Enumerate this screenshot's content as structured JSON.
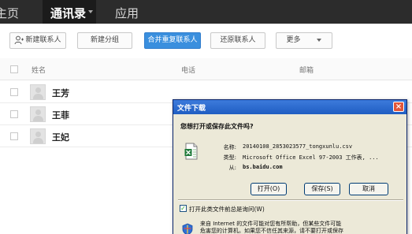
{
  "nav": {
    "home": "主页",
    "contacts": "通讯录",
    "apps": "应用"
  },
  "toolbar": {
    "new_contact": "新建联系人",
    "new_group": "新建分组",
    "merge": "合并重复联系人",
    "restore": "还原联系人",
    "more": "更多",
    "primary_color": "#3a8fde"
  },
  "table": {
    "columns": {
      "name": "姓名",
      "phone": "电话",
      "email": "邮箱"
    },
    "rows": [
      {
        "name": "王芳"
      },
      {
        "name": "王菲"
      },
      {
        "name": "王妃"
      }
    ]
  },
  "dialog": {
    "title": "文件下载",
    "question": "您想打开或保存此文件吗?",
    "fields": {
      "name_label": "名称:",
      "name_value": "20140108_2853023577_tongxunlu.csv",
      "type_label": "类型:",
      "type_value": "Microsoft Office Excel 97-2003 工作表, ...",
      "from_label": "从:",
      "from_value": "bs.baidu.com"
    },
    "buttons": {
      "open": "打开(O)",
      "save": "保存(S)",
      "cancel": "取消"
    },
    "always_ask_label": "打开此类文件前总是询问(W)",
    "always_ask_checked": true,
    "warning_line1": "来自 Internet 的文件可能对您有所帮助，但某些文件可能",
    "warning_line2": "危害您的计算机。如果您不信任其来源，请不要打开或保存"
  }
}
